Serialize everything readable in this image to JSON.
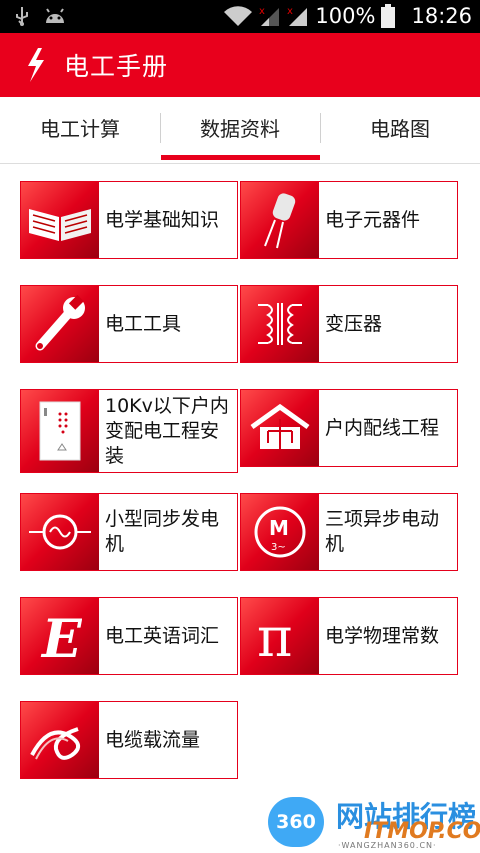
{
  "status_bar": {
    "battery": "100%",
    "time": "18:26",
    "icons": [
      "usb-icon",
      "android-icon",
      "wifi-icon",
      "signal-icon",
      "signal-icon",
      "battery-icon"
    ]
  },
  "app_bar": {
    "title": "电工手册",
    "logo_icon": "lightning-icon",
    "color": "#e8001c"
  },
  "tabs": [
    {
      "label": "电工计算",
      "selected": false
    },
    {
      "label": "数据资料",
      "selected": true
    },
    {
      "label": "电路图",
      "selected": false
    }
  ],
  "items": [
    {
      "label": "电学基础知识",
      "icon": "book-icon"
    },
    {
      "label": "电子元器件",
      "icon": "capacitor-icon"
    },
    {
      "label": "电工工具",
      "icon": "wrench-icon"
    },
    {
      "label": "变压器",
      "icon": "transformer-icon"
    },
    {
      "label": "10Kv以下户内变配电工程安装",
      "icon": "switchgear-cabinet-icon"
    },
    {
      "label": "户内配线工程",
      "icon": "house-wiring-icon"
    },
    {
      "label": "小型同步发电机",
      "icon": "generator-icon"
    },
    {
      "label": "三项异步电动机",
      "icon": "motor-icon"
    },
    {
      "label": "电工英语词汇",
      "icon": "letter-e-icon"
    },
    {
      "label": "电学物理常数",
      "icon": "pi-icon"
    },
    {
      "label": "电缆载流量",
      "icon": "cable-icon"
    }
  ],
  "watermark": {
    "circle_text": "360",
    "title": "网站排行榜",
    "brand": "ITMOP.COM",
    "url": "·WANGZHAN360.CN·"
  }
}
